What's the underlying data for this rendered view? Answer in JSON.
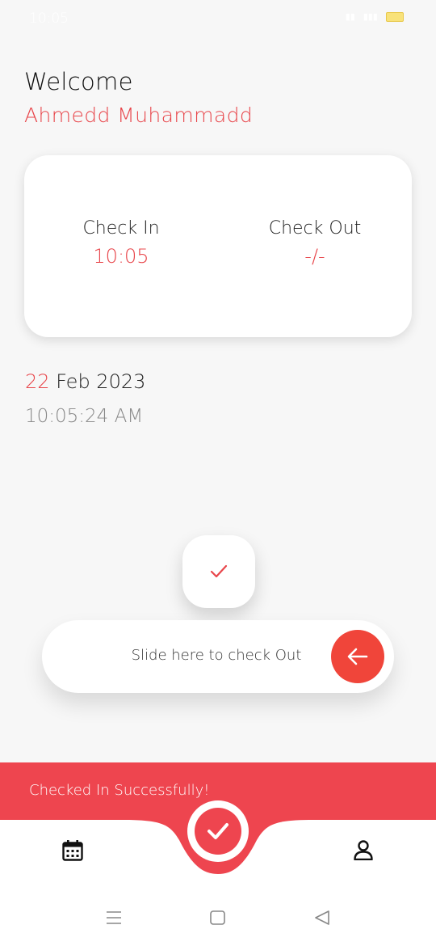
{
  "status_bar": {
    "time": "10:05"
  },
  "header": {
    "welcome": "Welcome",
    "user_name": "Ahmedd Muhammadd"
  },
  "attendance_card": {
    "check_in_label": "Check In",
    "check_in_value": "10:05",
    "check_out_label": "Check Out",
    "check_out_value": "-/-"
  },
  "date": {
    "day": "22",
    "month_year": "Feb 2023",
    "time": "10:05:24 AM"
  },
  "slider": {
    "label": "Slide here to check Out"
  },
  "toast": {
    "message": "Checked In Successfully!"
  },
  "bottom_nav": {
    "left_icon": "calendar-icon",
    "center_icon": "check-circle-icon",
    "right_icon": "person-icon"
  },
  "colors": {
    "accent": "#ee454f",
    "background": "#f7f7f7"
  }
}
